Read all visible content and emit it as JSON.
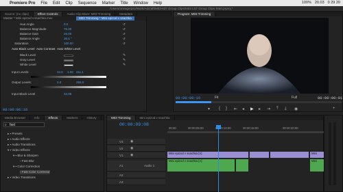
{
  "menubar": {
    "app": "Premiere Pro",
    "items": [
      "File",
      "Edit",
      "Clip",
      "Sequence",
      "Marker",
      "Title",
      "Window",
      "Help"
    ],
    "right": [
      "100%",
      "20.03",
      "0 29 20"
    ]
  },
  "path": "/Users/oneagerpro/Work/Adcraft/M03-637 Group Clips/M03 LST Group Clips Start.prproj *",
  "effect_controls": {
    "tabs": [
      "Source: (no clips)",
      "Effect Controls",
      "Audio Clip Mixer: M03 Trimming",
      "Metadata"
    ],
    "source": "Master * Mini epizod v.ssachka.mov",
    "clip_badge": "M03 Trimming * Mini epizod v ssachka",
    "properties": [
      {
        "name": "Hue Angle",
        "value": "0.0"
      },
      {
        "name": "Balance Magnitude",
        "value": "76.00"
      },
      {
        "name": "Balance Gain",
        "value": "26.00"
      },
      {
        "name": "Balance Angle",
        "value": "36.5 °"
      },
      {
        "name": "Saturation",
        "value": "100.00"
      }
    ],
    "auto_buttons": [
      "Auto Black Level",
      "Auto Contrast",
      "Auto White Level"
    ],
    "levels": [
      {
        "name": "Black Level",
        "color": "#000000"
      },
      {
        "name": "Gray Level",
        "color": "#7f7f7f"
      },
      {
        "name": "White Level",
        "color": "#ffffff"
      }
    ],
    "input_label": "Input Levels:",
    "input_values": [
      "34.0",
      "1.00",
      "211.1"
    ],
    "output_label": "Output Levels:",
    "output_values": [
      "0.0",
      "255.0"
    ],
    "input_black": {
      "name": "Input Black Level",
      "value": "34.08"
    },
    "timecode": "00:00:06:16"
  },
  "program": {
    "tab": "Program: M03 Trimming",
    "timecode_left": "00:00:09:16",
    "fit": "Fit",
    "quality": "Full",
    "timecode_right": "00:00:00:01"
  },
  "project": {
    "tabs": [
      "Media Browser",
      "Info",
      "Effects",
      "Markers",
      "History"
    ],
    "search_value": "fast",
    "tree": [
      {
        "label": "Presets",
        "indent": 0
      },
      {
        "label": "Audio Effects",
        "indent": 0
      },
      {
        "label": "Audio Transitions",
        "indent": 0
      },
      {
        "label": "Video Effects",
        "indent": 0
      },
      {
        "label": "Blur & Sharpen",
        "indent": 1
      },
      {
        "label": "Fast Blur",
        "indent": 2
      },
      {
        "label": "Color Correction",
        "indent": 1
      },
      {
        "label": "Fast Color Corrector",
        "indent": 2
      },
      {
        "label": "Video Transitions",
        "indent": 0
      }
    ]
  },
  "timeline": {
    "tabs": [
      "M03 Trimming",
      "Mini epizod v ssachka"
    ],
    "timecode": "00:00:09:08",
    "ruler": [
      "00:00",
      "00:00:05:00",
      "00:00:10:00",
      "00:00:15:00",
      "00:00:20:00"
    ],
    "tracks": [
      {
        "name": "V3"
      },
      {
        "name": "V2"
      },
      {
        "name": "V1"
      },
      {
        "name": "A1",
        "label": "Audio 1"
      },
      {
        "name": "A2"
      },
      {
        "name": "A3"
      }
    ],
    "clip_v": "Mini epizod v ssachka [V]",
    "clip_a": "Mini epizod v ssachka [A]",
    "clip_v2": "Mini",
    "clip_a2": "Mini"
  },
  "colors": {
    "accent": "#3d96f2",
    "clip_video": "#9b8fd4",
    "clip_audio": "#4fa84f",
    "playhead": "#2c8ae8"
  }
}
